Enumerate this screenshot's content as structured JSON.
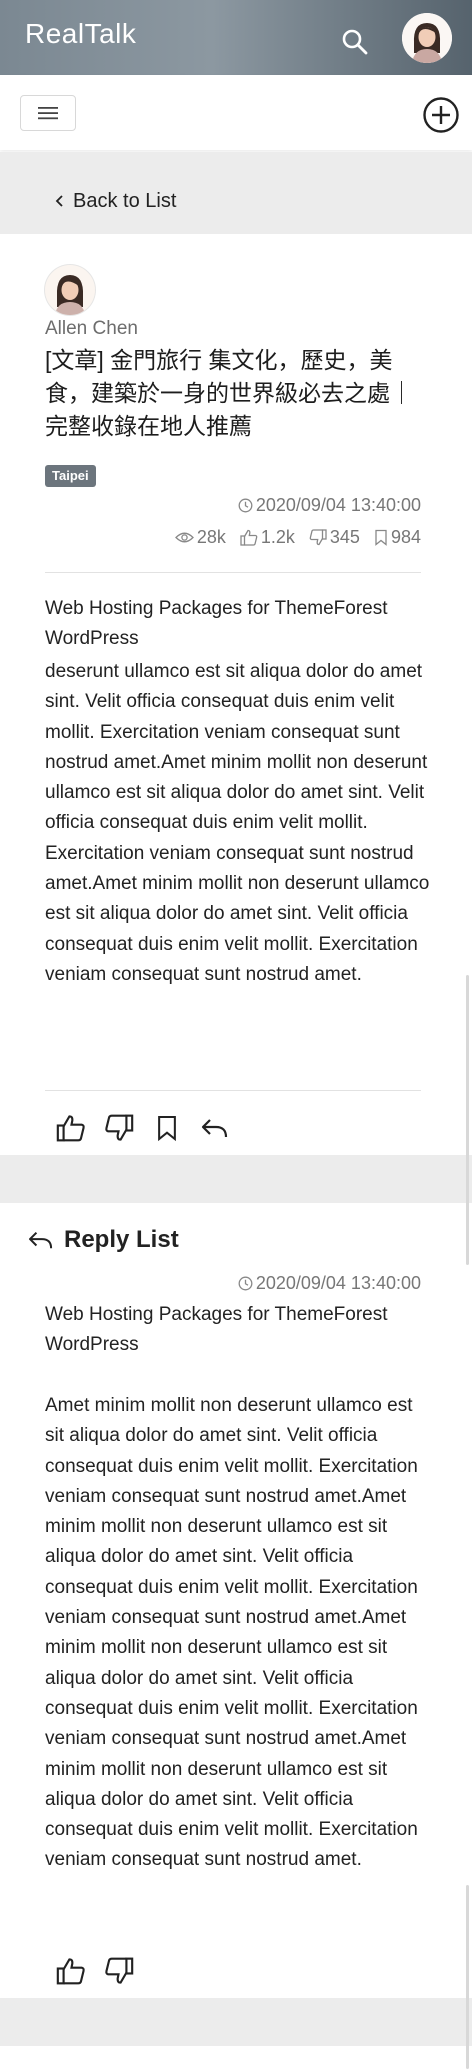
{
  "app": {
    "brand": "RealTalk",
    "icons": {
      "search": "search-icon",
      "avatar": "user-avatar",
      "menu": "hamburger-icon",
      "add": "plus-circle-icon"
    }
  },
  "nav": {
    "back_label": "Back to List"
  },
  "post": {
    "author": "Allen Chen",
    "title": "[文章] 金門旅行 集文化，歷史，美食，建築於一身的世界級必去之處｜完整收錄在地人推薦",
    "tag": "Taipei",
    "datetime": "2020/09/04 13:40:00",
    "stats": {
      "views": "28k",
      "likes": "1.2k",
      "dislikes": "345",
      "bookmarks": "984"
    },
    "content_heading": "Web Hosting Packages for ThemeForest WordPress",
    "content_body": "deserunt ullamco est sit aliqua dolor do amet sint. Velit officia consequat duis enim velit mollit. Exercitation veniam consequat sunt nostrud amet.Amet minim mollit non deserunt ullamco est sit aliqua dolor do amet sint. Velit officia consequat duis enim velit mollit. Exercitation veniam consequat sunt nostrud amet.Amet minim mollit non deserunt ullamco est sit aliqua dolor do amet sint. Velit officia consequat duis enim velit mollit. Exercitation veniam consequat sunt nostrud amet."
  },
  "replies": {
    "title": "Reply List",
    "items": [
      {
        "datetime": "2020/09/04 13:40:00",
        "heading": "Web Hosting Packages for ThemeForest WordPress",
        "body": "Amet minim mollit non deserunt ullamco est sit aliqua dolor do amet sint. Velit officia consequat duis enim velit mollit. Exercitation veniam consequat sunt nostrud amet.Amet minim mollit non deserunt ullamco est sit aliqua dolor do amet sint. Velit officia consequat duis enim velit mollit. Exercitation veniam consequat sunt nostrud amet.Amet minim mollit non deserunt ullamco est sit aliqua dolor do amet sint. Velit officia consequat duis enim velit mollit. Exercitation veniam consequat sunt nostrud amet.Amet minim mollit non deserunt ullamco est sit aliqua dolor do amet sint. Velit officia consequat duis enim velit mollit. Exercitation veniam consequat sunt nostrud amet."
      }
    ]
  },
  "colors": {
    "header": "#7b8892",
    "tag": "#6c757d",
    "band": "#ececec",
    "muted_text": "#777777"
  }
}
